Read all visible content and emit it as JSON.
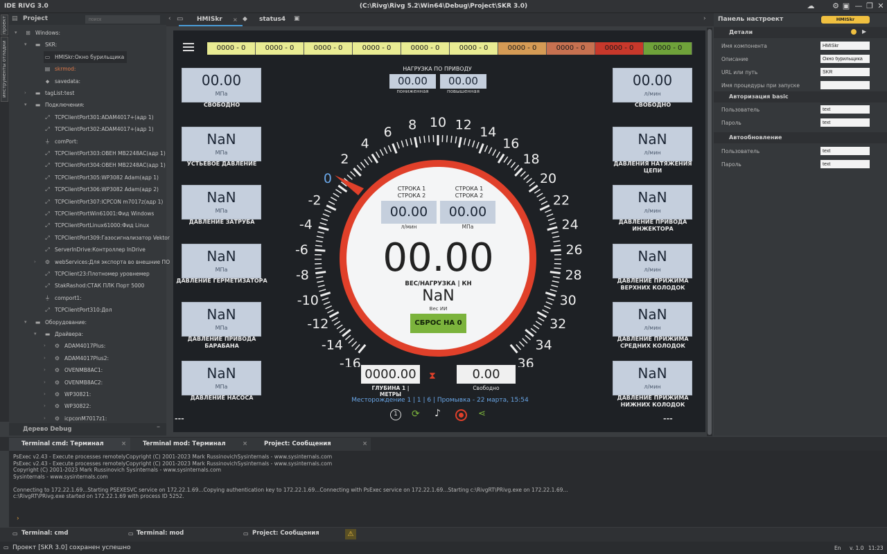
{
  "app": {
    "title": "IDE RIVG 3.0",
    "path": "(C:\\Rivg\\Rivg 5.2\\Win64\\Debug\\Project\\SKR 3.0)"
  },
  "vtabs": [
    "проект",
    "инструменты отладки"
  ],
  "project": {
    "title": "Project",
    "search_placeholder": "поиск",
    "tree": [
      {
        "label": "Windows:",
        "icon": "windows-icon",
        "indent": 0,
        "expand": "▾"
      },
      {
        "label": "SKR:",
        "icon": "folder-icon",
        "indent": 1,
        "expand": "▾"
      },
      {
        "label": "HMISkr:Окно бурильщика",
        "icon": "window-icon",
        "indent": 2,
        "selected": true
      },
      {
        "label": "skrmod:",
        "icon": "file-icon",
        "indent": 2,
        "color": "#e07a4a"
      },
      {
        "label": "savedata:",
        "icon": "tag-icon",
        "indent": 2
      },
      {
        "label": "tagList:test",
        "icon": "folder-icon",
        "indent": 1,
        "expand": "›"
      },
      {
        "label": "Подключения:",
        "icon": "folder-icon",
        "indent": 1,
        "expand": "▾"
      },
      {
        "label": "TCPClientPort301:ADAM4017+(адр 1)",
        "icon": "link-icon",
        "indent": 2
      },
      {
        "label": "TCPClientPort302:ADAM4017+(адр 1)",
        "icon": "link-icon",
        "indent": 2
      },
      {
        "label": "comPort:",
        "icon": "plug-icon",
        "indent": 2
      },
      {
        "label": "TCPClientPort303:ОВЕН МВ2248АС(адр 1)",
        "icon": "link-icon",
        "indent": 2
      },
      {
        "label": "TCPClientPort304:ОВЕН МВ2248АС(адр 1)",
        "icon": "link-icon",
        "indent": 2
      },
      {
        "label": "TCPClientPort305:WP3082 Adam(адр 1)",
        "icon": "link-icon",
        "indent": 2
      },
      {
        "label": "TCPClientPort306:WP3082 Adam(адр 2)",
        "icon": "link-icon",
        "indent": 2
      },
      {
        "label": "TCPClientPort307:ICPCON m7017z(адр 1)",
        "icon": "link-icon",
        "indent": 2
      },
      {
        "label": "TCPClientPortWin61001:Фид Windows",
        "icon": "link-icon",
        "indent": 2
      },
      {
        "label": "TCPClientPortLinux61000:Фид Linux",
        "icon": "link-icon",
        "indent": 2
      },
      {
        "label": "TCPClientPort309:Газосигнализатор Vektor",
        "icon": "link-icon",
        "indent": 2
      },
      {
        "label": "ServerInDrive:Контроллер InDrive",
        "icon": "link-icon",
        "indent": 2
      },
      {
        "label": "webServices:Для экспорта во внешние ПО",
        "icon": "gear-icon",
        "indent": 2,
        "expand": "›"
      },
      {
        "label": "TCPClient23:Плотномер уровнемер",
        "icon": "link-icon",
        "indent": 2
      },
      {
        "label": "StakRashod:СТАК ПЛК Порт 5000",
        "icon": "link-icon",
        "indent": 2
      },
      {
        "label": "comport1:",
        "icon": "plug-icon",
        "indent": 2
      },
      {
        "label": "TCPClientPort310:Дол",
        "icon": "link-icon",
        "indent": 2
      },
      {
        "label": "Оборудование:",
        "icon": "folder-icon",
        "indent": 1,
        "expand": "▾"
      },
      {
        "label": "Драйвера:",
        "icon": "folder-icon",
        "indent": 2,
        "expand": "▾"
      },
      {
        "label": "ADAM4017Plus:",
        "icon": "gears-icon",
        "indent": 3,
        "expand": "›"
      },
      {
        "label": "ADAM4017Plus2:",
        "icon": "gears-icon",
        "indent": 3,
        "expand": "›"
      },
      {
        "label": "OVENMB8AC1:",
        "icon": "gears-icon",
        "indent": 3,
        "expand": "›"
      },
      {
        "label": "OVENMB8AC2:",
        "icon": "gears-icon",
        "indent": 3,
        "expand": "›"
      },
      {
        "label": "WP30821:",
        "icon": "gears-icon",
        "indent": 3,
        "expand": "›"
      },
      {
        "label": "WP30822:",
        "icon": "gears-icon",
        "indent": 3,
        "expand": "›"
      },
      {
        "label": "icpconM7017z1:",
        "icon": "gears-icon",
        "indent": 3,
        "expand": "›"
      }
    ]
  },
  "debug_tree": "Дерево Debug",
  "doc_tabs": [
    {
      "label": "HMISkr",
      "close": "×"
    },
    {
      "label": "status4"
    }
  ],
  "hmi": {
    "status": [
      {
        "text": "0000 - 0",
        "color": "#e9ec93"
      },
      {
        "text": "0000 - 0",
        "color": "#e9ec93"
      },
      {
        "text": "0000 - 0",
        "color": "#e9ec93"
      },
      {
        "text": "0000 - 0",
        "color": "#e9ec93"
      },
      {
        "text": "0000 - 0",
        "color": "#e9ec93"
      },
      {
        "text": "0000 - 0",
        "color": "#e9ec93"
      },
      {
        "text": "0000 - 0",
        "color": "#d59b55"
      },
      {
        "text": "0000 - 0",
        "color": "#c77150"
      },
      {
        "text": "0000 - 0",
        "color": "#c8382b"
      },
      {
        "text": "0000 - 0",
        "color": "#6fa23a"
      }
    ],
    "left": [
      {
        "value": "00.00",
        "unit": "МПа",
        "caption": "СВОБОДНО"
      },
      {
        "value": "NaN",
        "unit": "МПа",
        "caption": "УСТЬЕВОЕ ДАВЛЕНИЕ"
      },
      {
        "value": "NaN",
        "unit": "МПа",
        "caption": "ДАВЛЕНИЕ ЗАТРУБА"
      },
      {
        "value": "NaN",
        "unit": "МПа",
        "caption": "ДАВЛЕНИЕ ГЕРМЕТИЗАТОРА"
      },
      {
        "value": "NaN",
        "unit": "МПа",
        "caption": "ДАВЛЕНИЕ ПРИВОДА БАРАБАНА"
      },
      {
        "value": "NaN",
        "unit": "МПа",
        "caption": "ДАВЛЕНИЕ НАСОСА"
      }
    ],
    "right": [
      {
        "value": "00.00",
        "unit": "л/мин",
        "caption": "СВОБОДНО"
      },
      {
        "value": "NaN",
        "unit": "л/мин",
        "caption": "ДАВЛЕНИЯ НАТЯЖЕНИЯ ЦЕПИ"
      },
      {
        "value": "NaN",
        "unit": "л/мин",
        "caption": "ДАВЛЕНИЕ ПРИВОДА ИНЖЕКТОРА"
      },
      {
        "value": "NaN",
        "unit": "л/мин",
        "caption": "ДАВЛЕНИЕ ПРИЖИМА ВЕРХНИХ КОЛОДОК"
      },
      {
        "value": "NaN",
        "unit": "л/мин",
        "caption": "ДАВЛЕНИЕ ПРИЖИМА СРЕДНИХ КОЛОДОК"
      },
      {
        "value": "NaN",
        "unit": "л/мин",
        "caption": "ДАВЛЕНИЕ ПРИЖИМА НИЖНИХ КОЛОДОК"
      }
    ],
    "load": {
      "title": "НАГРУЗКА ПО ПРИВОДУ",
      "low_value": "00.00",
      "low_label": "пониженная",
      "high_value": "00.00",
      "high_label": "повышенная"
    },
    "dial_labels": [
      "-16",
      "-14",
      "-12",
      "-10",
      "-8",
      "-6",
      "-4",
      "-2",
      "0",
      "2",
      "4",
      "6",
      "8",
      "10",
      "12",
      "14",
      "16",
      "18",
      "20",
      "22",
      "24",
      "26",
      "28",
      "30",
      "32",
      "34",
      "36"
    ],
    "center": {
      "row_left": "СТРОКА 1\nСТРОКА 2",
      "row_right": "СТРОКА 1\nСТРОКА 2",
      "val_left": "00.00",
      "unit_left": "л/мин",
      "val_right": "00.00",
      "unit_right": "МПа",
      "main": "00.00",
      "main_label": "ВЕС/НАГРУЗКА | КН",
      "nan": "NaN",
      "ves": "Вес ИИ",
      "reset": "СБРОС НА 0"
    },
    "depth": {
      "value": "0000.00",
      "label": "ГЛУБИНА 1 | МЕТРЫ"
    },
    "free": {
      "value": "0.00",
      "label": "Свободно"
    },
    "footer": "Месторождение 1 | 1 | 6 | Промывка - 22 марта, 15:54",
    "dashes": "---",
    "accent": "#e0402a"
  },
  "rpanel": {
    "title": "Панель настроект",
    "badge": "HMISkr",
    "details": "Детали",
    "fields": [
      {
        "label": "Имя компонента",
        "value": "HMISkr"
      },
      {
        "label": "Описание",
        "value": "Окно бурильщика"
      },
      {
        "label": "URL или путь",
        "value": "SKR"
      },
      {
        "label": "Имя процедуры при запуске",
        "value": ""
      }
    ],
    "auth": "Авторизация basic",
    "user": "Пользователь",
    "pass": "Пароль",
    "text": "text",
    "autoupdate": "Автообновление"
  },
  "bottom_tabs": [
    "Terminal cmd: Терминал",
    "Terminal mod: Терминал",
    "Project: Сообщения"
  ],
  "terminal": "PsExec v2.43 - Execute processes remotelyCopyright (C) 2001-2023 Mark RussinovichSysinternals - www.sysinternals.com\nPsExec v2.43 - Execute processes remotelyCopyright (C) 2001-2023 Mark RussinovichSysinternals - www.sysinternals.com\nCopyright (C) 2001-2023 Mark Russinovich Sysinternals - www.sysinternals.com\nSysinternals - www.sysinternals.com\n\nConnecting to 172.22.1.69...Starting PSEXESVC service on 172.22.1.69...Copying authentication key to 172.22.1.69...Connecting with PsExec service on 172.22.1.69...Starting c:\\RivgRT\\PRivg.exe on 172.22.1.69...\nc:\\RivgRT\\PRivg.exe started on 172.22.1.69 with process ID 5252.",
  "prompt": "›",
  "bar2": [
    "Terminal: cmd",
    "Terminal: mod",
    "Project: Сообщения"
  ],
  "status": {
    "text": "Проект [SKR 3.0] сохранен успешно",
    "lang": "En",
    "version": "v. 1.0",
    "time": "11:23"
  }
}
